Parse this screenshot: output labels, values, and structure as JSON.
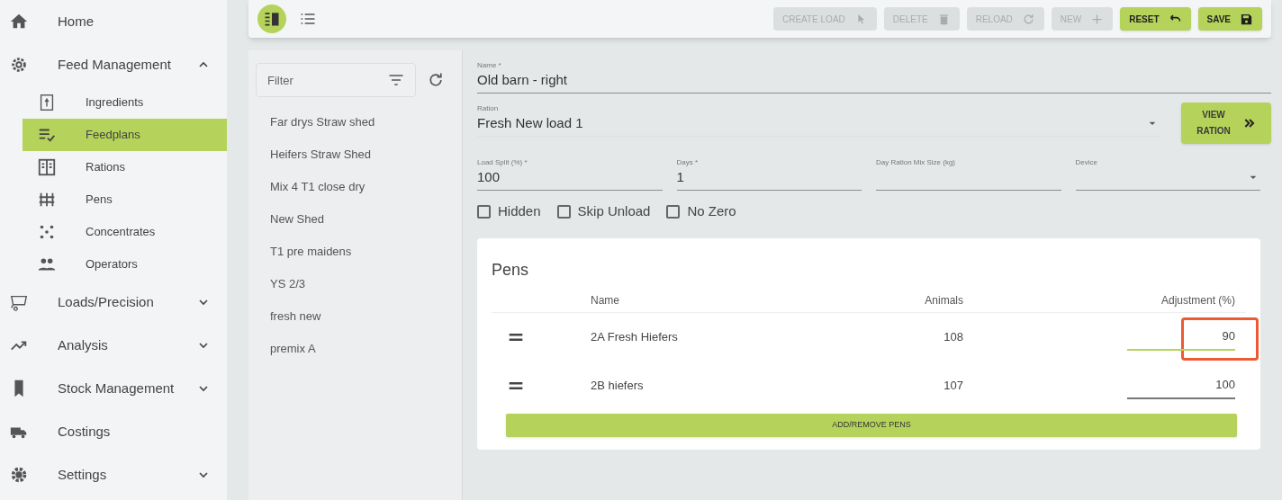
{
  "sidebar": {
    "items": [
      {
        "label": "Home",
        "selected": false
      },
      {
        "label": "Feed Management",
        "expanded": true,
        "selected": false,
        "children": [
          {
            "label": "Ingredients",
            "selected": false
          },
          {
            "label": "Feedplans",
            "selected": true
          },
          {
            "label": "Rations",
            "selected": false
          },
          {
            "label": "Pens",
            "selected": false
          },
          {
            "label": "Concentrates",
            "selected": false
          },
          {
            "label": "Operators",
            "selected": false
          }
        ]
      },
      {
        "label": "Loads/Precision",
        "expanded": false,
        "selected": false
      },
      {
        "label": "Analysis",
        "expanded": false,
        "selected": false
      },
      {
        "label": "Stock Management",
        "expanded": false,
        "selected": false
      },
      {
        "label": "Costings",
        "selected": false
      },
      {
        "label": "Settings",
        "expanded": false,
        "selected": false
      }
    ]
  },
  "toolbar": {
    "views": [
      {
        "selected": true
      },
      {
        "selected": false
      }
    ],
    "buttons": [
      {
        "label": "CREATE LOAD",
        "disabled": true
      },
      {
        "label": "DELETE",
        "disabled": true
      },
      {
        "label": "RELOAD",
        "disabled": true
      },
      {
        "label": "NEW",
        "disabled": true
      },
      {
        "label": "RESET",
        "disabled": false
      },
      {
        "label": "SAVE",
        "disabled": false
      }
    ]
  },
  "list": {
    "filter": {
      "placeholder": "Filter"
    },
    "items": [
      "Far drys Straw shed",
      "Heifers Straw Shed",
      "Mix 4 T1 close dry",
      "New Shed",
      "T1 pre maidens",
      "YS 2/3",
      "fresh new",
      "premix A"
    ]
  },
  "form": {
    "name": {
      "label": "Name *",
      "value": "Old barn - right"
    },
    "ration": {
      "label": "Ration",
      "value": "Fresh New load 1"
    },
    "view_ration_button": "VIEW RATION",
    "fields": [
      {
        "label": "Load Split (%) *",
        "value": "100",
        "kind": "text"
      },
      {
        "label": "Days *",
        "value": "1",
        "kind": "text"
      },
      {
        "label": "Day Ration Mix Size (kg)",
        "kind": "text"
      },
      {
        "label": "Device",
        "kind": "select"
      }
    ],
    "checkboxes": [
      {
        "label": "Hidden",
        "checked": false
      },
      {
        "label": "Skip Unload",
        "checked": false
      },
      {
        "label": "No Zero",
        "checked": false
      }
    ]
  },
  "pens": {
    "title": "Pens",
    "columns": [
      "Name",
      "Animals",
      "Adjustment (%)"
    ],
    "rows": [
      {
        "name": "2A Fresh Hiefers",
        "animals": "108",
        "adjustment": "90",
        "focused": true,
        "highlighted": true
      },
      {
        "name": "2B hiefers",
        "animals": "107",
        "adjustment": "100",
        "focused": false,
        "highlighted": false
      }
    ],
    "button": "ADD/REMOVE PENS"
  }
}
